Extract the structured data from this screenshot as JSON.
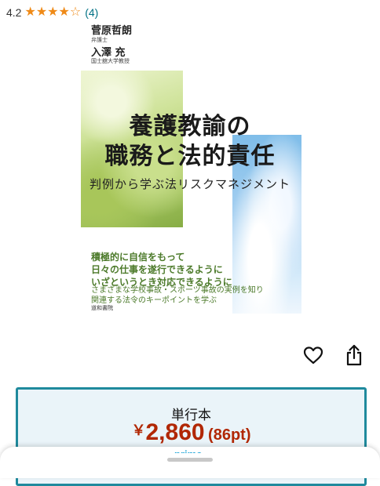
{
  "rating": {
    "value": "4.2",
    "stars": [
      "★",
      "★",
      "★",
      "★",
      "☆"
    ],
    "count": "(4)",
    "star_color": "#ef8a17",
    "count_color": "#007185"
  },
  "book": {
    "author1_name": "菅原哲朗",
    "author1_role": "弁護士",
    "author2_name": "入澤 充",
    "author2_role": "国士舘大学教授",
    "title_line1": "養護教諭の",
    "title_line2": "職務と法的責任",
    "subtitle": "判例から学ぶ法リスクマネジメント",
    "blurb": [
      "積極的に自信をもって",
      "日々の仕事を遂行できるように",
      "いざというとき対応できるように"
    ],
    "blurb_small": [
      "さまざまな学校事故・スポーツ事故の実例を知り",
      "関連する法令のキーポイントを学ぶ"
    ],
    "publisher": "道和書院"
  },
  "actions": {
    "heart_icon": "heart-outline-icon",
    "share_icon": "share-icon"
  },
  "price": {
    "format": "単行本",
    "currency": "￥",
    "amount": "2,860",
    "points": "(86pt)",
    "price_color": "#b12704",
    "border_color": "#1f8a9d"
  },
  "sheet": {
    "peek_text": "prime"
  }
}
